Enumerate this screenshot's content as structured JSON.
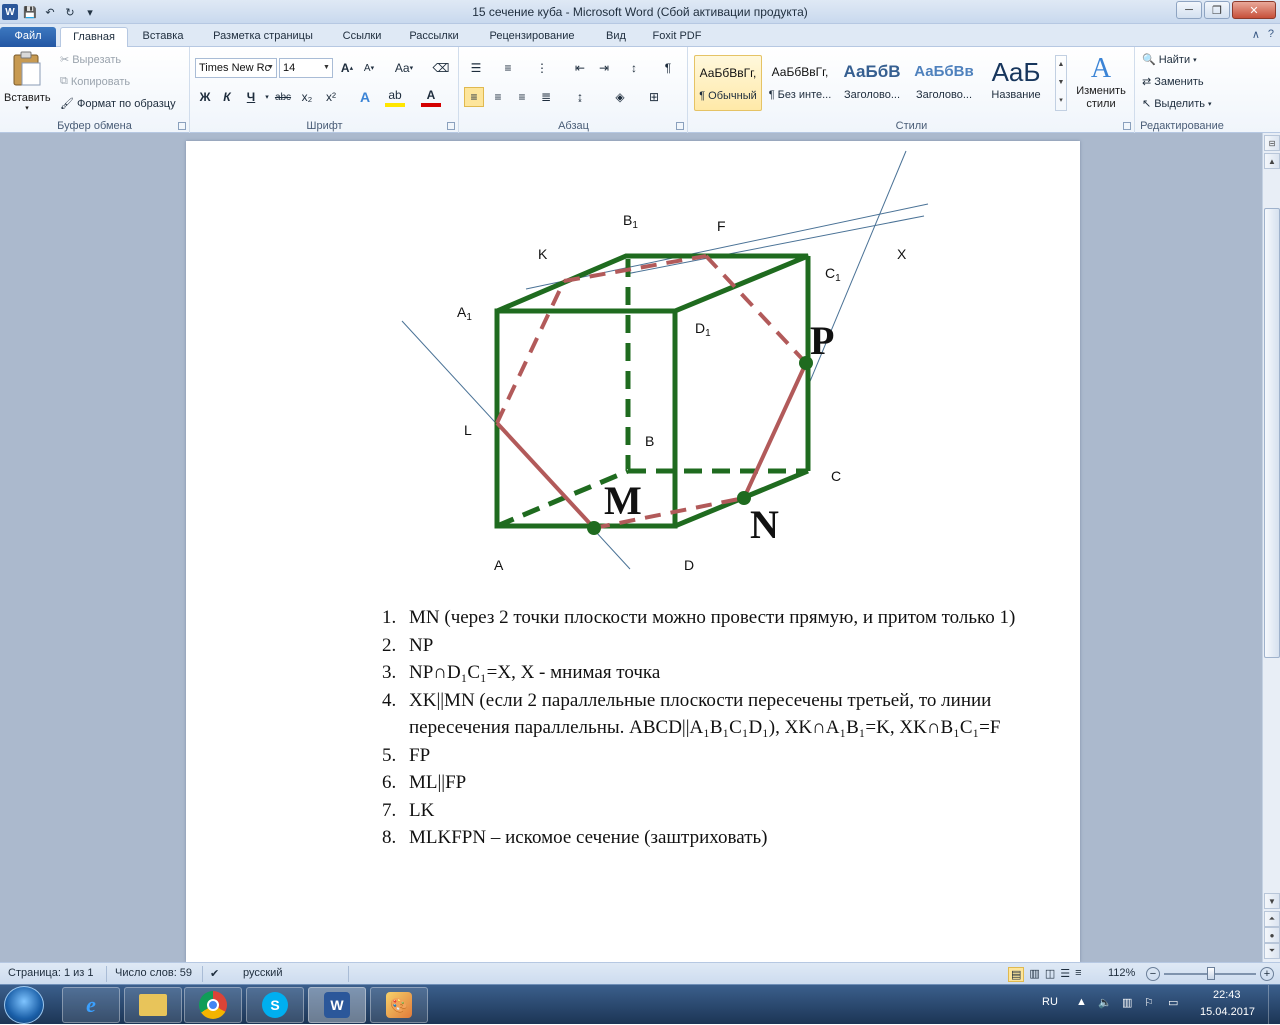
{
  "titlebar": {
    "title": "15 сечение куба  -  Microsoft Word (Сбой активации продукта)",
    "app_icon": "W",
    "save_icon": "💾",
    "undo_icon": "↶",
    "redo_icon": "↻",
    "qat_more": "▾",
    "minimize": "─",
    "restore": "❐",
    "close": "✕"
  },
  "tabs": [
    {
      "label": "Файл",
      "kind": "file"
    },
    {
      "label": "Главная",
      "kind": "active"
    },
    {
      "label": "Вставка"
    },
    {
      "label": "Разметка страницы"
    },
    {
      "label": "Ссылки"
    },
    {
      "label": "Рассылки"
    },
    {
      "label": "Рецензирование"
    },
    {
      "label": "Вид"
    },
    {
      "label": "Foxit PDF"
    }
  ],
  "tab_help": {
    "collapse": "∧",
    "help": "?"
  },
  "clipboard": {
    "group": "Буфер обмена",
    "paste": "Вставить",
    "cut": "Вырезать",
    "copy": "Копировать",
    "format_painter": "Формат по образцу"
  },
  "font": {
    "group": "Шрифт",
    "family": "Times New Rc",
    "size": "14",
    "grow": "A",
    "shrink": "A",
    "case": "Aa",
    "bold": "Ж",
    "italic": "К",
    "underline": "Ч",
    "strike": "abc",
    "subscript": "x₂",
    "superscript": "x²"
  },
  "paragraph": {
    "group": "Абзац"
  },
  "styles": {
    "group": "Стили",
    "items": [
      {
        "sample": "АаБбВвГг,",
        "name": "¶ Обычный",
        "selected": true
      },
      {
        "sample": "АаБбВвГг,",
        "name": "¶ Без инте..."
      },
      {
        "sample": "АаБбВ",
        "name": "Заголово..."
      },
      {
        "sample": "АаБбВв",
        "name": "Заголово..."
      },
      {
        "sample": "AaБ",
        "name": "Название"
      }
    ],
    "change": "Изменить стили"
  },
  "editing": {
    "group": "Редактирование",
    "find": "Найти",
    "replace": "Заменить",
    "select": "Выделить"
  },
  "figure": {
    "labels": {
      "B1": "B",
      "F": "F",
      "K": "K",
      "C1": "C",
      "X": "X",
      "A1": "A",
      "D1": "D",
      "P": "P",
      "L": "L",
      "B": "B",
      "C": "C",
      "M": "M",
      "N": "N",
      "A": "A",
      "D": "D",
      "sub1": "1"
    }
  },
  "steps": [
    {
      "num": "1.",
      "text": "MN (через 2 точки плоскости можно провести прямую, и притом только 1)"
    },
    {
      "num": "2.",
      "text": "NP"
    },
    {
      "num": "3.",
      "text": "NP∩D₁C₁=X, X - мнимая точка"
    },
    {
      "num": "4.",
      "text": "XK||MN (если 2 параллельные плоскости пересечены третьей, то линии пересечения параллельны. ABCD||A₁B₁C₁D₁), XK∩A₁B₁=K, XK∩B₁C₁=F"
    },
    {
      "num": "5.",
      "text": "FP"
    },
    {
      "num": "6.",
      "text": "ML||FP"
    },
    {
      "num": "7.",
      "text": "LK"
    },
    {
      "num": "8.",
      "text": "MLKFPN – искомое сечение (заштриховать)"
    }
  ],
  "statusbar": {
    "page": "Страница: 1 из 1",
    "words": "Число слов: 59",
    "language": "русский",
    "zoom": "112%",
    "zoom_minus": "−",
    "zoom_plus": "+"
  },
  "taskbar": {
    "lang": "RU",
    "time": "22:43",
    "date": "15.04.2017"
  },
  "colors": {
    "cube": "#1f6b1f",
    "section": "#b25a5a",
    "aux_line": "#4a7296",
    "ribbon_accent": "#2b579a"
  }
}
